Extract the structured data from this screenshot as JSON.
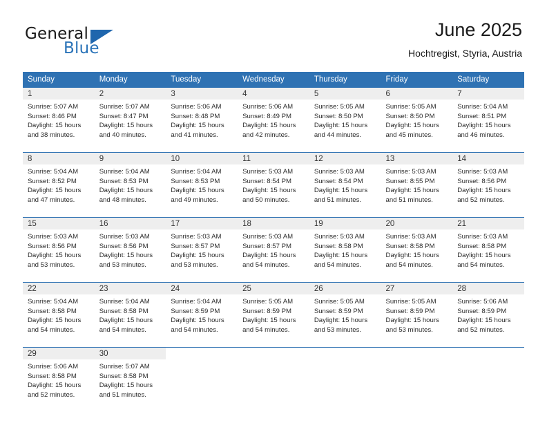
{
  "brand": {
    "name_top": "General",
    "name_bottom": "Blue",
    "triangle_color": "#1f66ad",
    "blue_color": "#2a73b8"
  },
  "header": {
    "title": "June 2025",
    "location": "Hochtregist, Styria, Austria"
  },
  "theme": {
    "header_blue": "#2f72b3",
    "daynum_band": "#eeeeee",
    "text": "#222222"
  },
  "calendar": {
    "weekdays": [
      "Sunday",
      "Monday",
      "Tuesday",
      "Wednesday",
      "Thursday",
      "Friday",
      "Saturday"
    ],
    "weeks": [
      [
        {
          "day": "1",
          "sunrise": "Sunrise: 5:07 AM",
          "sunset": "Sunset: 8:46 PM",
          "daylight1": "Daylight: 15 hours",
          "daylight2": "and 38 minutes."
        },
        {
          "day": "2",
          "sunrise": "Sunrise: 5:07 AM",
          "sunset": "Sunset: 8:47 PM",
          "daylight1": "Daylight: 15 hours",
          "daylight2": "and 40 minutes."
        },
        {
          "day": "3",
          "sunrise": "Sunrise: 5:06 AM",
          "sunset": "Sunset: 8:48 PM",
          "daylight1": "Daylight: 15 hours",
          "daylight2": "and 41 minutes."
        },
        {
          "day": "4",
          "sunrise": "Sunrise: 5:06 AM",
          "sunset": "Sunset: 8:49 PM",
          "daylight1": "Daylight: 15 hours",
          "daylight2": "and 42 minutes."
        },
        {
          "day": "5",
          "sunrise": "Sunrise: 5:05 AM",
          "sunset": "Sunset: 8:50 PM",
          "daylight1": "Daylight: 15 hours",
          "daylight2": "and 44 minutes."
        },
        {
          "day": "6",
          "sunrise": "Sunrise: 5:05 AM",
          "sunset": "Sunset: 8:50 PM",
          "daylight1": "Daylight: 15 hours",
          "daylight2": "and 45 minutes."
        },
        {
          "day": "7",
          "sunrise": "Sunrise: 5:04 AM",
          "sunset": "Sunset: 8:51 PM",
          "daylight1": "Daylight: 15 hours",
          "daylight2": "and 46 minutes."
        }
      ],
      [
        {
          "day": "8",
          "sunrise": "Sunrise: 5:04 AM",
          "sunset": "Sunset: 8:52 PM",
          "daylight1": "Daylight: 15 hours",
          "daylight2": "and 47 minutes."
        },
        {
          "day": "9",
          "sunrise": "Sunrise: 5:04 AM",
          "sunset": "Sunset: 8:53 PM",
          "daylight1": "Daylight: 15 hours",
          "daylight2": "and 48 minutes."
        },
        {
          "day": "10",
          "sunrise": "Sunrise: 5:04 AM",
          "sunset": "Sunset: 8:53 PM",
          "daylight1": "Daylight: 15 hours",
          "daylight2": "and 49 minutes."
        },
        {
          "day": "11",
          "sunrise": "Sunrise: 5:03 AM",
          "sunset": "Sunset: 8:54 PM",
          "daylight1": "Daylight: 15 hours",
          "daylight2": "and 50 minutes."
        },
        {
          "day": "12",
          "sunrise": "Sunrise: 5:03 AM",
          "sunset": "Sunset: 8:54 PM",
          "daylight1": "Daylight: 15 hours",
          "daylight2": "and 51 minutes."
        },
        {
          "day": "13",
          "sunrise": "Sunrise: 5:03 AM",
          "sunset": "Sunset: 8:55 PM",
          "daylight1": "Daylight: 15 hours",
          "daylight2": "and 51 minutes."
        },
        {
          "day": "14",
          "sunrise": "Sunrise: 5:03 AM",
          "sunset": "Sunset: 8:56 PM",
          "daylight1": "Daylight: 15 hours",
          "daylight2": "and 52 minutes."
        }
      ],
      [
        {
          "day": "15",
          "sunrise": "Sunrise: 5:03 AM",
          "sunset": "Sunset: 8:56 PM",
          "daylight1": "Daylight: 15 hours",
          "daylight2": "and 53 minutes."
        },
        {
          "day": "16",
          "sunrise": "Sunrise: 5:03 AM",
          "sunset": "Sunset: 8:56 PM",
          "daylight1": "Daylight: 15 hours",
          "daylight2": "and 53 minutes."
        },
        {
          "day": "17",
          "sunrise": "Sunrise: 5:03 AM",
          "sunset": "Sunset: 8:57 PM",
          "daylight1": "Daylight: 15 hours",
          "daylight2": "and 53 minutes."
        },
        {
          "day": "18",
          "sunrise": "Sunrise: 5:03 AM",
          "sunset": "Sunset: 8:57 PM",
          "daylight1": "Daylight: 15 hours",
          "daylight2": "and 54 minutes."
        },
        {
          "day": "19",
          "sunrise": "Sunrise: 5:03 AM",
          "sunset": "Sunset: 8:58 PM",
          "daylight1": "Daylight: 15 hours",
          "daylight2": "and 54 minutes."
        },
        {
          "day": "20",
          "sunrise": "Sunrise: 5:03 AM",
          "sunset": "Sunset: 8:58 PM",
          "daylight1": "Daylight: 15 hours",
          "daylight2": "and 54 minutes."
        },
        {
          "day": "21",
          "sunrise": "Sunrise: 5:03 AM",
          "sunset": "Sunset: 8:58 PM",
          "daylight1": "Daylight: 15 hours",
          "daylight2": "and 54 minutes."
        }
      ],
      [
        {
          "day": "22",
          "sunrise": "Sunrise: 5:04 AM",
          "sunset": "Sunset: 8:58 PM",
          "daylight1": "Daylight: 15 hours",
          "daylight2": "and 54 minutes."
        },
        {
          "day": "23",
          "sunrise": "Sunrise: 5:04 AM",
          "sunset": "Sunset: 8:58 PM",
          "daylight1": "Daylight: 15 hours",
          "daylight2": "and 54 minutes."
        },
        {
          "day": "24",
          "sunrise": "Sunrise: 5:04 AM",
          "sunset": "Sunset: 8:59 PM",
          "daylight1": "Daylight: 15 hours",
          "daylight2": "and 54 minutes."
        },
        {
          "day": "25",
          "sunrise": "Sunrise: 5:05 AM",
          "sunset": "Sunset: 8:59 PM",
          "daylight1": "Daylight: 15 hours",
          "daylight2": "and 54 minutes."
        },
        {
          "day": "26",
          "sunrise": "Sunrise: 5:05 AM",
          "sunset": "Sunset: 8:59 PM",
          "daylight1": "Daylight: 15 hours",
          "daylight2": "and 53 minutes."
        },
        {
          "day": "27",
          "sunrise": "Sunrise: 5:05 AM",
          "sunset": "Sunset: 8:59 PM",
          "daylight1": "Daylight: 15 hours",
          "daylight2": "and 53 minutes."
        },
        {
          "day": "28",
          "sunrise": "Sunrise: 5:06 AM",
          "sunset": "Sunset: 8:59 PM",
          "daylight1": "Daylight: 15 hours",
          "daylight2": "and 52 minutes."
        }
      ],
      [
        {
          "day": "29",
          "sunrise": "Sunrise: 5:06 AM",
          "sunset": "Sunset: 8:58 PM",
          "daylight1": "Daylight: 15 hours",
          "daylight2": "and 52 minutes."
        },
        {
          "day": "30",
          "sunrise": "Sunrise: 5:07 AM",
          "sunset": "Sunset: 8:58 PM",
          "daylight1": "Daylight: 15 hours",
          "daylight2": "and 51 minutes."
        },
        {
          "day": "",
          "sunrise": "",
          "sunset": "",
          "daylight1": "",
          "daylight2": ""
        },
        {
          "day": "",
          "sunrise": "",
          "sunset": "",
          "daylight1": "",
          "daylight2": ""
        },
        {
          "day": "",
          "sunrise": "",
          "sunset": "",
          "daylight1": "",
          "daylight2": ""
        },
        {
          "day": "",
          "sunrise": "",
          "sunset": "",
          "daylight1": "",
          "daylight2": ""
        },
        {
          "day": "",
          "sunrise": "",
          "sunset": "",
          "daylight1": "",
          "daylight2": ""
        }
      ]
    ]
  }
}
